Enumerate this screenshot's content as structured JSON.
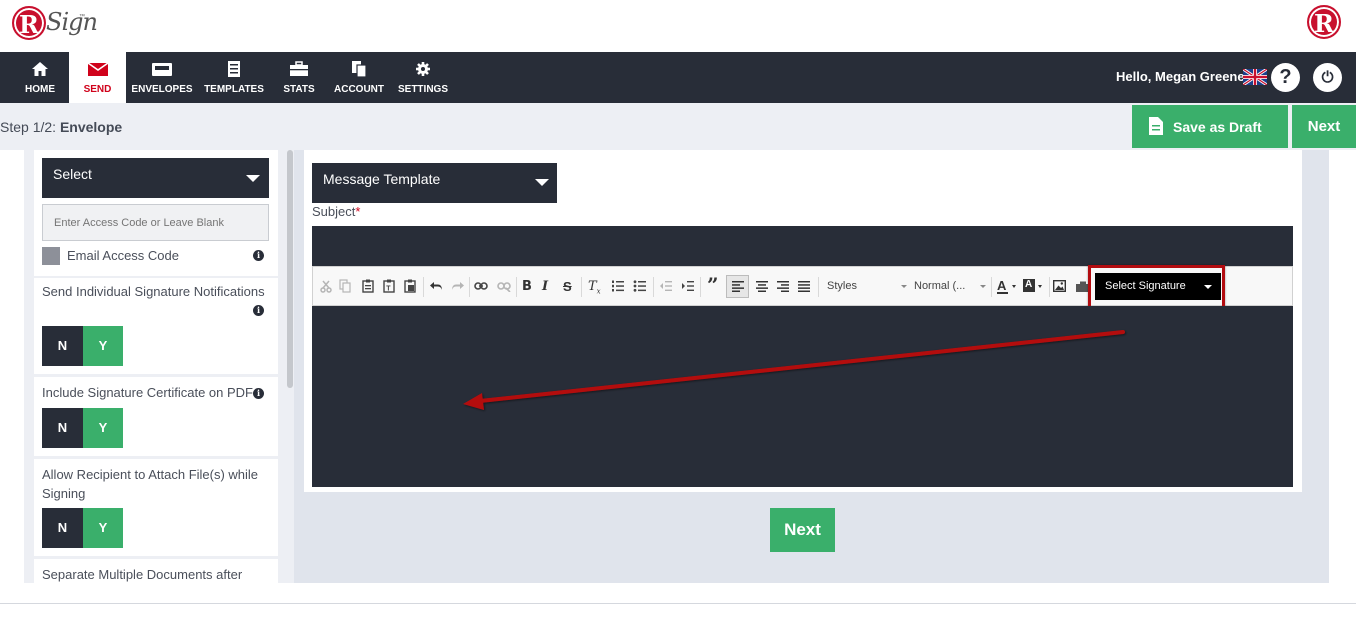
{
  "header": {
    "logo_text": "Sign",
    "logo_tm": "™",
    "logo_letter": "R"
  },
  "nav": {
    "items": [
      {
        "label": "HOME",
        "icon": "home-icon"
      },
      {
        "label": "SEND",
        "icon": "envelope-icon",
        "active": true
      },
      {
        "label": "ENVELOPES",
        "icon": "inbox-icon"
      },
      {
        "label": "TEMPLATES",
        "icon": "document-icon"
      },
      {
        "label": "STATS",
        "icon": "briefcase-icon"
      },
      {
        "label": "ACCOUNT",
        "icon": "copy-icon"
      },
      {
        "label": "SETTINGS",
        "icon": "gear-icon"
      }
    ],
    "greeting": "Hello, Megan Greene",
    "help_glyph": "?",
    "power_glyph": "⏻"
  },
  "step": {
    "prefix": "Step 1/2:",
    "name": "Envelope",
    "save_draft_label": "Save as Draft",
    "next_label": "Next"
  },
  "left": {
    "select_label": "Select",
    "access_code_placeholder": "Enter Access Code or Leave Blank",
    "email_access_code_label": "Email Access Code",
    "options": [
      {
        "label": "Send Individual Signature Notifications",
        "no": "N",
        "yes": "Y"
      },
      {
        "label": "Include Signature Certificate on PDF",
        "no": "N",
        "yes": "Y"
      },
      {
        "label": "Allow Recipient to Attach File(s) while Signing",
        "no": "N",
        "yes": "Y"
      },
      {
        "label": "Separate Multiple Documents after"
      }
    ]
  },
  "editor": {
    "message_template_label": "Message Template",
    "subject_label": "Subject",
    "required_mark": "*",
    "styles_label": "Styles",
    "format_label": "Normal (...",
    "select_signature_label": "Select Signature",
    "bottom_next_label": "Next"
  },
  "colors": {
    "nav_bg": "#282d38",
    "accent_green": "#3aaf6b",
    "brand_red": "#c8102e",
    "annotation_red": "#b30c10"
  }
}
